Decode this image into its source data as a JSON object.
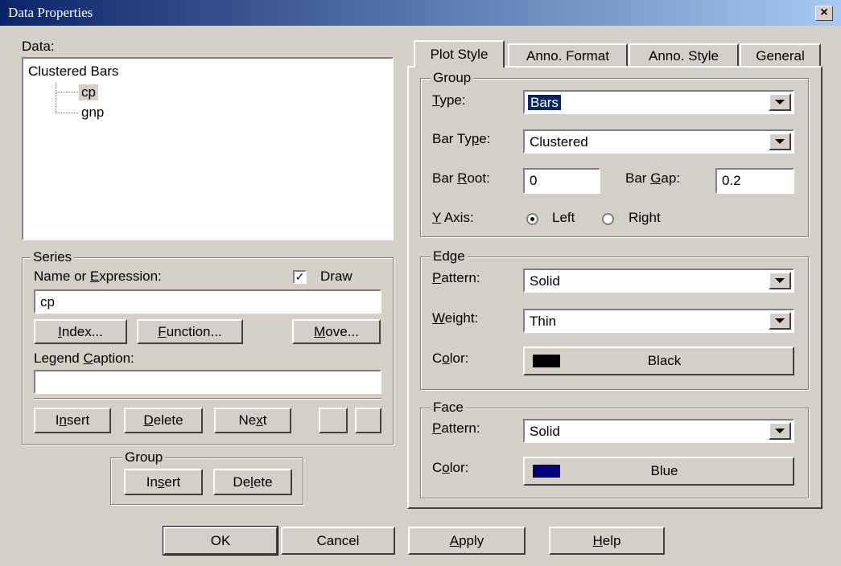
{
  "window": {
    "title": "Data Properties",
    "close_glyph": "×"
  },
  "data_panel": {
    "label": "Data:",
    "tree": {
      "root": "Clustered Bars",
      "children": [
        "cp",
        "gnp"
      ],
      "selected": "cp"
    }
  },
  "series": {
    "legend": "Series",
    "name_label": "Name or Expression:",
    "draw_label": "Draw",
    "draw_checked": true,
    "name_value": "cp",
    "index_button": "Index...",
    "function_button": "Function...",
    "move_button": "Move...",
    "legend_caption_label": "Legend Caption:",
    "legend_caption_value": "",
    "insert_button": "Insert",
    "delete_button": "Delete",
    "next_button": "Next"
  },
  "group_box": {
    "legend": "Group",
    "insert_button": "Insert",
    "delete_button": "Delete"
  },
  "tabs": [
    "Plot Style",
    "Anno. Format",
    "Anno. Style",
    "General"
  ],
  "active_tab": "Plot Style",
  "plot_style": {
    "group": {
      "legend": "Group",
      "type_label": "Type:",
      "type_value": "Bars",
      "bar_type_label": "Bar Type:",
      "bar_type_value": "Clustered",
      "bar_root_label": "Bar Root:",
      "bar_root_value": "0",
      "bar_gap_label": "Bar Gap:",
      "bar_gap_value": "0.2",
      "y_axis_label": "Y Axis:",
      "y_axis_left": "Left",
      "y_axis_right": "Right",
      "y_axis_selected": "Left"
    },
    "edge": {
      "legend": "Edge",
      "pattern_label": "Pattern:",
      "pattern_value": "Solid",
      "weight_label": "Weight:",
      "weight_value": "Thin",
      "color_label": "Color:",
      "color_name": "Black",
      "color_hex": "#000000"
    },
    "face": {
      "legend": "Face",
      "pattern_label": "Pattern:",
      "pattern_value": "Solid",
      "color_label": "Color:",
      "color_name": "Blue",
      "color_hex": "#000080"
    }
  },
  "footer": {
    "ok_button": "OK",
    "cancel_button": "Cancel",
    "apply_button": "Apply",
    "help_button": "Help"
  },
  "colors": {
    "dialog_bg": "#d4d0c8",
    "title_start": "#0a246a",
    "title_end": "#a6caf0",
    "selection": "#0a246a"
  }
}
